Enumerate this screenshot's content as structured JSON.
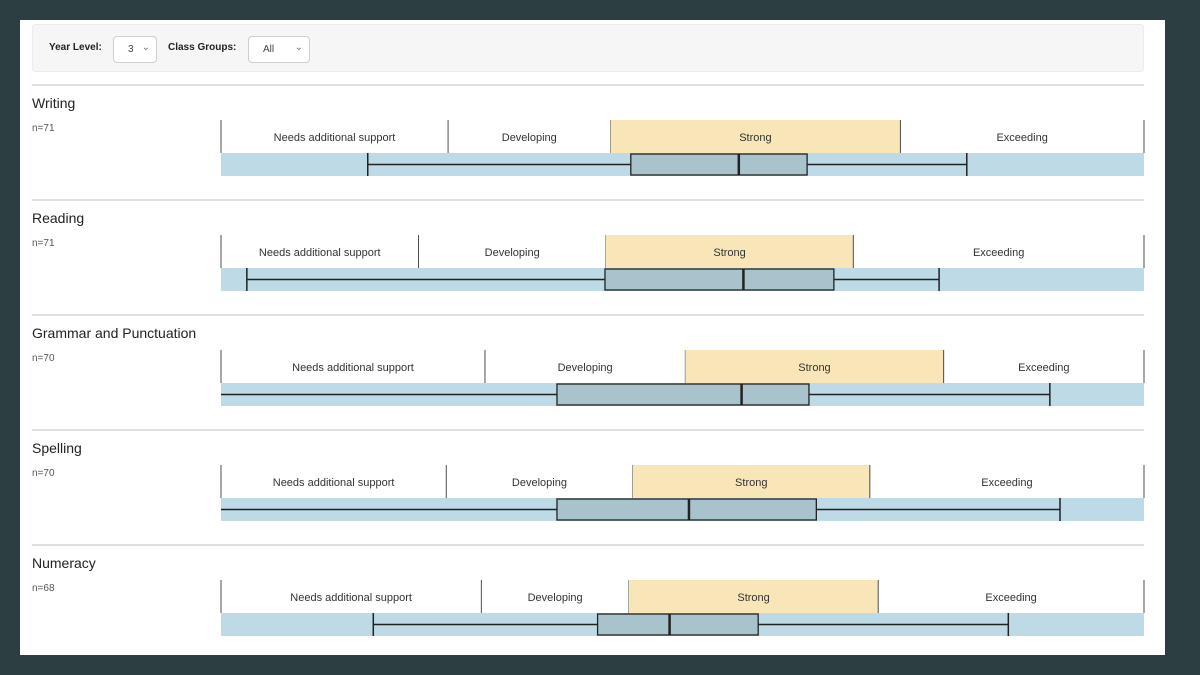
{
  "filters": {
    "year_level_label": "Year Level:",
    "year_level_value": "3",
    "class_groups_label": "Class Groups:",
    "class_groups_value": "All"
  },
  "colors": {
    "band_strong": "#f8e5b8",
    "track": "#bddae6",
    "box_fill": "#a9c3cd",
    "line": "#222222",
    "divider": "#cccccc"
  },
  "chart_data": {
    "type": "boxplot",
    "scale": [
      0,
      100
    ],
    "sections": [
      {
        "title": "Writing",
        "n": "n=71",
        "bands": [
          {
            "label": "Needs additional support",
            "end": 24.6
          },
          {
            "label": "Developing",
            "end": 42.2
          },
          {
            "label": "Strong",
            "end": 73.6
          },
          {
            "label": "Exceeding",
            "end": 100
          }
        ],
        "highlight": "Strong",
        "stats": {
          "min": 15.9,
          "q1": 44.4,
          "median": 56.1,
          "q3": 63.5,
          "max": 80.8
        }
      },
      {
        "title": "Reading",
        "n": "n=71",
        "bands": [
          {
            "label": "Needs additional support",
            "end": 21.4
          },
          {
            "label": "Developing",
            "end": 41.7
          },
          {
            "label": "Strong",
            "end": 68.5
          },
          {
            "label": "Exceeding",
            "end": 100
          }
        ],
        "highlight": "Strong",
        "stats": {
          "min": 2.8,
          "q1": 41.6,
          "median": 56.6,
          "q3": 66.4,
          "max": 77.8
        }
      },
      {
        "title": "Grammar and Punctuation",
        "n": "n=70",
        "bands": [
          {
            "label": "Needs additional support",
            "end": 28.6
          },
          {
            "label": "Developing",
            "end": 50.3
          },
          {
            "label": "Strong",
            "end": 78.3
          },
          {
            "label": "Exceeding",
            "end": 100
          }
        ],
        "highlight": "Strong",
        "stats": {
          "min": 0,
          "q1": 36.4,
          "median": 56.4,
          "q3": 63.7,
          "max": 89.8
        }
      },
      {
        "title": "Spelling",
        "n": "n=70",
        "bands": [
          {
            "label": "Needs additional support",
            "end": 24.4
          },
          {
            "label": "Developing",
            "end": 44.6
          },
          {
            "label": "Strong",
            "end": 70.3
          },
          {
            "label": "Exceeding",
            "end": 100
          }
        ],
        "highlight": "Strong",
        "stats": {
          "min": 0,
          "q1": 36.4,
          "median": 50.7,
          "q3": 64.5,
          "max": 90.9
        }
      },
      {
        "title": "Numeracy",
        "n": "n=68",
        "bands": [
          {
            "label": "Needs additional support",
            "end": 28.2
          },
          {
            "label": "Developing",
            "end": 44.2
          },
          {
            "label": "Strong",
            "end": 71.2
          },
          {
            "label": "Exceeding",
            "end": 100
          }
        ],
        "highlight": "Strong",
        "stats": {
          "min": 16.5,
          "q1": 40.8,
          "median": 48.6,
          "q3": 58.2,
          "max": 85.3
        }
      }
    ]
  }
}
